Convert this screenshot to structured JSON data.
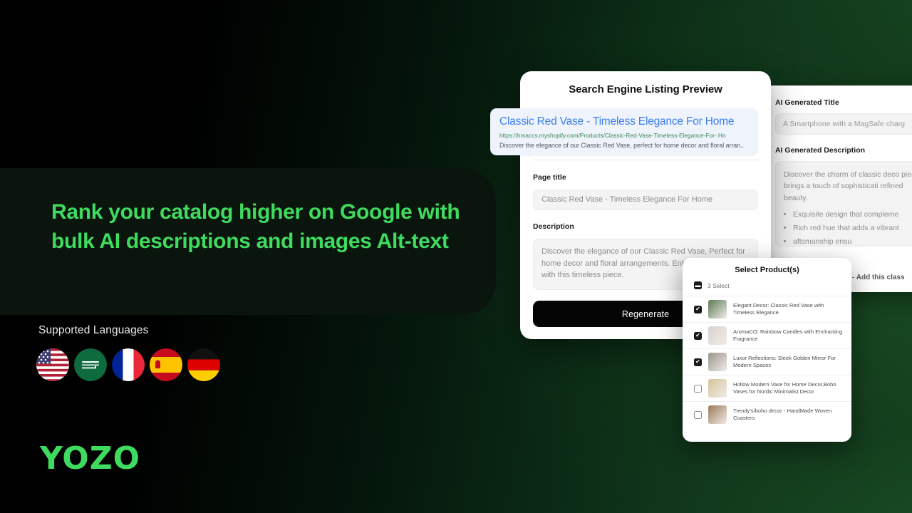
{
  "hero": {
    "headline": "Rank your catalog higher on Google with bulk AI descriptions and images Alt-text",
    "languages_label": "Supported Languages",
    "logo": "YOZO",
    "accent_color": "#3fdb5f",
    "flags": [
      {
        "name": "flag-united-states",
        "label": "United States"
      },
      {
        "name": "flag-saudi-arabia",
        "label": "Saudi Arabia"
      },
      {
        "name": "flag-france",
        "label": "France"
      },
      {
        "name": "flag-spain",
        "label": "Spain"
      },
      {
        "name": "flag-germany",
        "label": "Germany"
      }
    ]
  },
  "listing_card": {
    "title": "Search Engine Listing Preview",
    "serp": {
      "title": "Classic Red Vase - Timeless Elegance For Home",
      "url": "https://hmaccs.myshopify.com/Products/Classic-Red-Vase-Timeless-Elegance-For- Ho",
      "description": "Discover the elegance of our Classic Red Vase, perfect for home decor and floral arran..",
      "title_color": "#3d7fe8",
      "url_color": "#3d8a54"
    },
    "page_title_label": "Page title",
    "page_title_value": "Classic Red Vase - Timeless Elegance For Home",
    "description_label": "Description",
    "description_value": "Discover the elegance of our Classic Red Vase, Perfect for home decor and floral arrangements. Enhance your space with this timeless piece.",
    "regenerate_label": "Regenerate"
  },
  "ai_card": {
    "title_label": "AI Generated Title",
    "title_value": "A Smartphone with a MagSafe charg",
    "description_label": "AI Generated Description",
    "description_value": "Discover the charm of classic deco piece brings a touch of sophisticati refined beauty.",
    "bullets": [
      "Exquisite design that compleme",
      "Rich red hue that adds a vibrant",
      "aftsmanship ensu"
    ],
    "add_class_label": "- Add this class"
  },
  "select_panel": {
    "title": "Select Product(s)",
    "select_all_label": "3 Select",
    "select_all_state": "indeterminate",
    "products": [
      {
        "name": "Elegant Decor: Classic Red Vase with Timeless Elegance",
        "checked": true,
        "thumb": "#5d7a55"
      },
      {
        "name": "AromaCO: Rainbow Candles with Enchanting Fragrance",
        "checked": true,
        "thumb": "#d9d2cf"
      },
      {
        "name": "Luxor Reflections: Sleek Golden Mirror For Modern Spaces",
        "checked": true,
        "thumb": "#9a9489"
      },
      {
        "name": "Hollow Modern Vase for Home Decor,Boho Vases for Nordic Minimalist Decor",
        "checked": false,
        "thumb": "#d5c49b"
      },
      {
        "name": "Trendy's/boho decor - HandMade Woven Coasters",
        "checked": false,
        "thumb": "#9c7a55"
      }
    ]
  }
}
